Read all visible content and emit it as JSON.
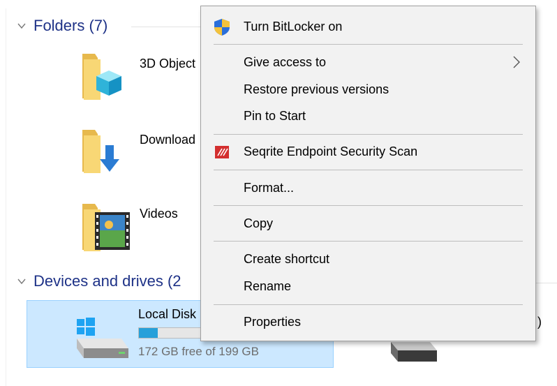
{
  "explorer": {
    "groups": {
      "folders": {
        "title": "Folders (7)"
      },
      "devices": {
        "title": "Devices and drives (2"
      }
    },
    "folders": [
      {
        "label": "3D Object",
        "icon": "3d-objects-folder-icon"
      },
      {
        "label": "Download",
        "icon": "downloads-folder-icon"
      },
      {
        "label": "Videos",
        "icon": "videos-folder-icon"
      }
    ],
    "drive": {
      "label": "Local Disk",
      "free_text": "172 GB free of 199 GB",
      "used_fraction": 0.136,
      "icon": "windows-drive-icon"
    },
    "second_drive_partial": ")"
  },
  "context_menu": {
    "items": [
      {
        "label": "Turn BitLocker on",
        "icon": "uac-shield-icon"
      },
      {
        "label": "Give access to",
        "submenu": true
      },
      {
        "label": "Restore previous versions"
      },
      {
        "label": "Pin to Start"
      },
      {
        "label": "Seqrite Endpoint Security Scan",
        "icon": "seqrite-icon"
      },
      {
        "label": "Format..."
      },
      {
        "label": "Copy"
      },
      {
        "label": "Create shortcut"
      },
      {
        "label": "Rename"
      },
      {
        "label": "Properties"
      }
    ]
  },
  "colors": {
    "group_header": "#1e3287",
    "selection_bg": "#cce8ff",
    "selection_border": "#99d1ff",
    "drive_fill": "#26a0da",
    "menu_bg": "#f2f2f2",
    "seqrite_red": "#d32f2f"
  }
}
